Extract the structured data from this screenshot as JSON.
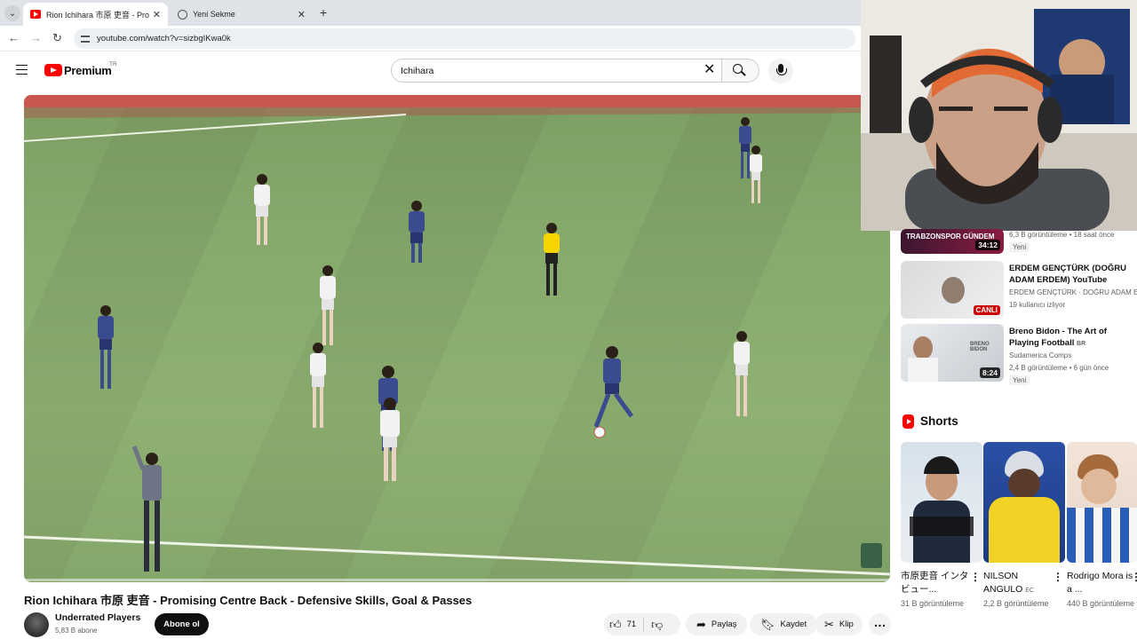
{
  "browser": {
    "tabs": [
      {
        "title": "Rion Ichihara 市原 吏音 - Promi",
        "active": true
      },
      {
        "title": "Yeni Sekme",
        "active": false
      }
    ],
    "url": "youtube.com/watch?v=sizbgIKwa0k"
  },
  "header": {
    "brand": "Premium",
    "region": "TR",
    "search_value": "Ichihara"
  },
  "video": {
    "title": "Rion Ichihara 市原 吏音 - Promising Centre Back - Defensive Skills, Goal & Passes",
    "channel": "Underrated Players",
    "subscribers": "5,83 B abone",
    "subscribe_label": "Abone ol",
    "likes": "71",
    "share_label": "Paylaş",
    "save_label": "Kaydet",
    "clip_label": "Klip"
  },
  "related": [
    {
      "title": "",
      "channel": "",
      "meta": "6,3 B görüntüleme • 18 saat önce",
      "badge": "Yeni",
      "duration": "34:12",
      "thumb_text": "TRABZONSPOR GÜNDEM"
    },
    {
      "title": "ERDEM GENÇTÜRK (DOĞRU ADAM ERDEM) YouTube STAN...",
      "channel": "ERDEM GENÇTÜRK · DOĞRU ADAM ERDEM",
      "meta": "19 kullanıcı izliyor",
      "live": "CANLI"
    },
    {
      "title": "Breno Bidon - The Art of Playing Football",
      "badge_suffix": "BR",
      "channel": "Sudamerica Comps",
      "meta": "2,4 B görüntüleme • 6 gün önce",
      "badge": "Yeni",
      "duration": "8:24",
      "thumb_text": "BRENO BIDON"
    }
  ],
  "shorts": {
    "title": "Shorts",
    "items": [
      {
        "title": "市原吏音 インタビュー...",
        "views": "31 B görüntüleme"
      },
      {
        "title": "NILSON ANGULO",
        "suffix": "EC",
        "views": "2,2 B görüntüleme"
      },
      {
        "title": "Rodrigo Mora is a ...",
        "views": "440 B görüntüleme"
      }
    ]
  },
  "colors": {
    "brand_red": "#ff0000",
    "pitch_green": "#87a96c",
    "home_kit": "#3b4b8f",
    "away_kit": "#f2f2f2",
    "referee": "#f5d400"
  }
}
